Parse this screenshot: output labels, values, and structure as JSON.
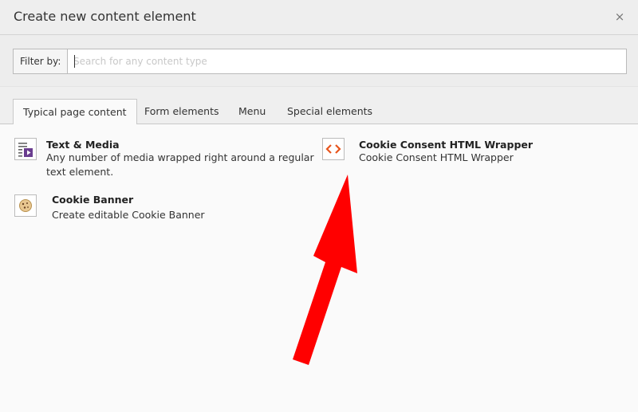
{
  "modal": {
    "title": "Create new content element",
    "close_label": "×"
  },
  "filter": {
    "label": "Filter by:",
    "placeholder": "Search for any content type",
    "value": ""
  },
  "tabs": [
    {
      "label": "Typical page content",
      "active": true
    },
    {
      "label": "Form elements",
      "active": false
    },
    {
      "label": "Menu",
      "active": false
    },
    {
      "label": "Special elements",
      "active": false
    }
  ],
  "elements": [
    {
      "title": "Text & Media",
      "description": "Any number of media wrapped right around a regular text element.",
      "icon": "text-media-icon"
    },
    {
      "title": "Cookie Consent HTML Wrapper",
      "description": "Cookie Consent HTML Wrapper",
      "icon": "html-code-icon"
    },
    {
      "title": "Cookie Banner",
      "description": "Create editable Cookie Banner",
      "icon": "cookie-icon"
    }
  ],
  "annotation": {
    "arrow_color": "#ff0000",
    "icon": "red-arrow-icon"
  }
}
